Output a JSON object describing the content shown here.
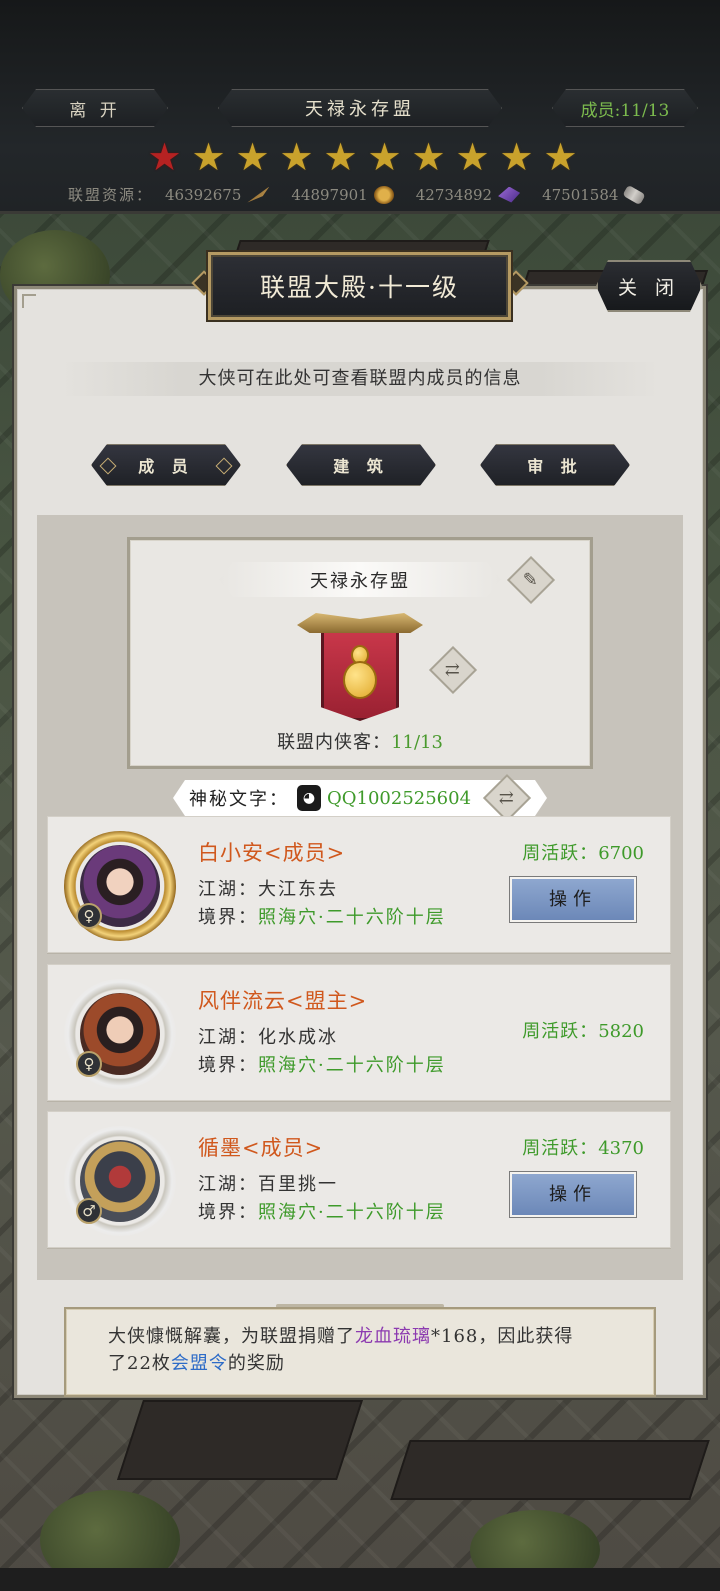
{
  "topbar": {
    "leave_label": "离 开",
    "alliance_name": "天禄永存盟",
    "members_label": "成员:11/13",
    "stars": {
      "filled_red": 1,
      "filled_gold": 9,
      "total": 10
    },
    "resources_label": "联盟资源：",
    "resources": [
      {
        "value": "46392675",
        "icon": "feather-icon"
      },
      {
        "value": "44897901",
        "icon": "coin-icon"
      },
      {
        "value": "42734892",
        "icon": "crystal-icon"
      },
      {
        "value": "47501584",
        "icon": "scroll-icon"
      }
    ]
  },
  "panel": {
    "title": "联盟大殿·十一级",
    "close_label": "关 闭",
    "intro": "大侠可在此处可查看联盟内成员的信息",
    "tabs": [
      {
        "label": "成 员",
        "active": true
      },
      {
        "label": "建 筑",
        "active": false
      },
      {
        "label": "审 批",
        "active": false
      }
    ]
  },
  "alliance_card": {
    "name": "天禄永存盟",
    "member_count_label": "联盟内侠客：",
    "member_count": "11/13",
    "banner_icon": "gourd-banner-icon"
  },
  "secret": {
    "label": "神秘文字：",
    "value": "QQ1002525604",
    "icon": "qq-icon"
  },
  "members": [
    {
      "name": "白小安<成员>",
      "jianghu_label": "江湖：",
      "jianghu": "大江东去",
      "realm_label": "境界：",
      "realm": "照海穴·二十六阶十层",
      "active_label": "周活跃：",
      "active": "6700",
      "gender": "♀",
      "has_action": true,
      "action_label": "操作"
    },
    {
      "name": "风伴流云<盟主>",
      "jianghu_label": "江湖：",
      "jianghu": "化水成冰",
      "realm_label": "境界：",
      "realm": "照海穴·二十六阶十层",
      "active_label": "周活跃：",
      "active": "5820",
      "gender": "♀",
      "has_action": false,
      "action_label": ""
    },
    {
      "name": "循墨<成员>",
      "jianghu_label": "江湖：",
      "jianghu": "百里挑一",
      "realm_label": "境界：",
      "realm": "照海穴·二十六阶十层",
      "active_label": "周活跃：",
      "active": "4370",
      "gender": "♂",
      "has_action": true,
      "action_label": "操作"
    }
  ],
  "notice": {
    "part1": "大侠慷慨解囊，为联盟捐赠了",
    "item": "龙血琉璃",
    "part2": "*168，因此获得",
    "part3": "了22枚",
    "reward": "会盟令",
    "part4": "的奖励"
  },
  "colors": {
    "name_orange": "#d0581d",
    "green_value": "#3e9a2a",
    "button_blue": "#7a95c2",
    "star_gold": "#c9a22c",
    "star_red": "#b52222",
    "item_purple": "#8c3ab0",
    "reward_blue": "#2d6bc7"
  }
}
